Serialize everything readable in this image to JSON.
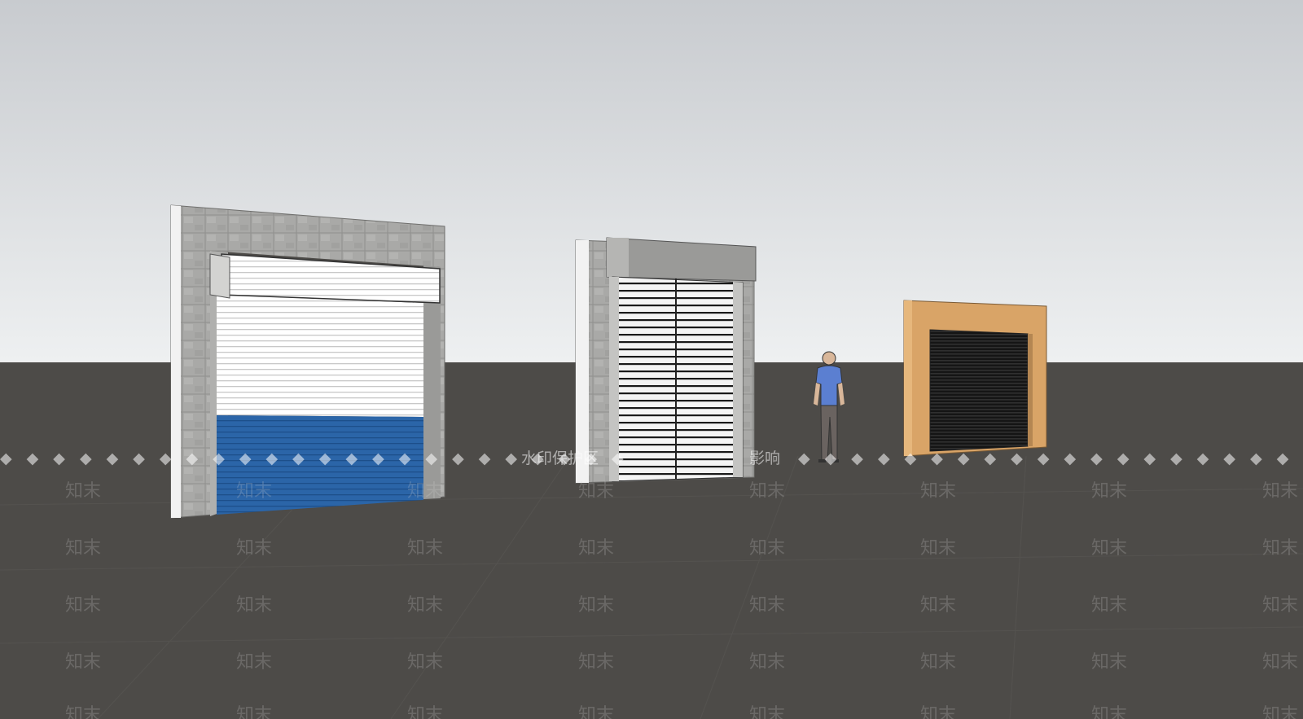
{
  "scene": {
    "sky_top": "#c9ccd0",
    "sky_bottom": "#eceef0",
    "ground": "#4d4b48"
  },
  "watermark": {
    "band_text": "水印保护区",
    "band_text_tail": "影响",
    "tile_text": "知末"
  }
}
